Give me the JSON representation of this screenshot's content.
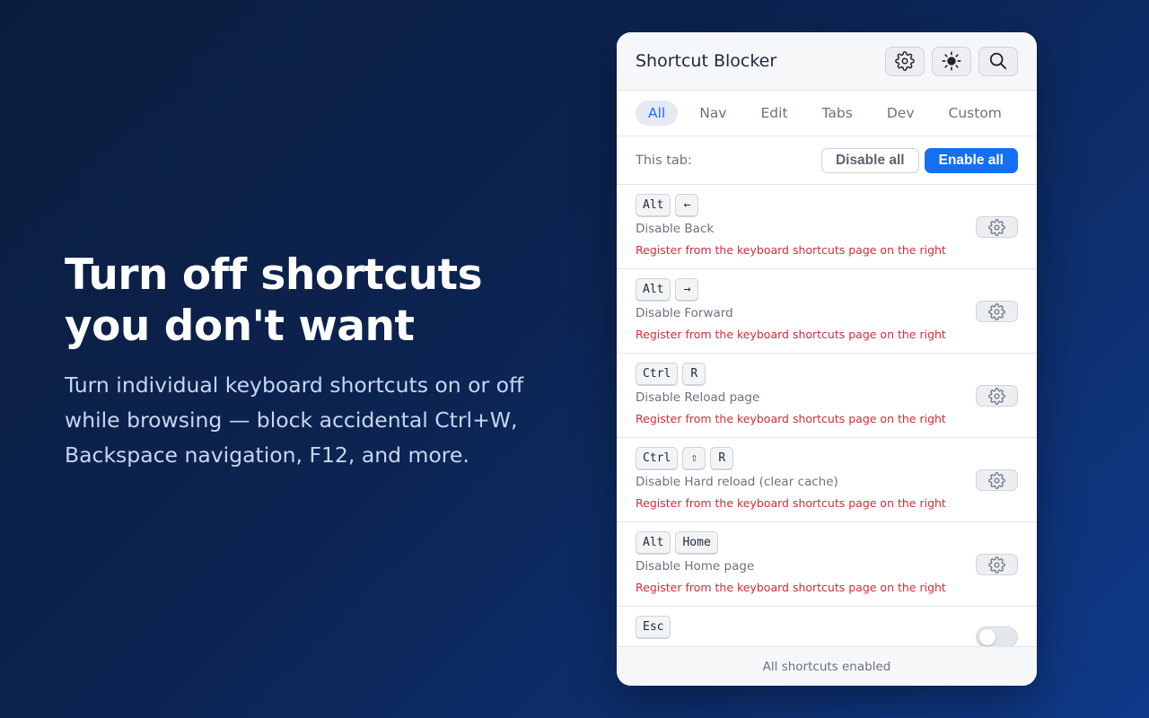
{
  "hero": {
    "title": "Turn off shortcuts you don't want",
    "subtitle": "Turn individual keyboard shortcuts on or off while browsing — block accidental Ctrl+W, Backspace navigation, F12, and more."
  },
  "panel": {
    "title": "Shortcut Blocker",
    "header_icons": [
      "gear-icon",
      "sun-icon",
      "search-icon"
    ],
    "tabs": [
      "All",
      "Nav",
      "Edit",
      "Tabs",
      "Dev",
      "Custom"
    ],
    "active_tab": "All",
    "this_tab_label": "This tab:",
    "disable_all_label": "Disable all",
    "enable_all_label": "Enable all",
    "rows": [
      {
        "keys": [
          "Alt",
          "←"
        ],
        "label": "Disable Back",
        "note": "Register from the keyboard shortcuts page on the right"
      },
      {
        "keys": [
          "Alt",
          "→"
        ],
        "label": "Disable Forward",
        "note": "Register from the keyboard shortcuts page on the right"
      },
      {
        "keys": [
          "Ctrl",
          "R"
        ],
        "label": "Disable Reload page",
        "note": "Register from the keyboard shortcuts page on the right"
      },
      {
        "keys": [
          "Ctrl",
          "⇧",
          "R"
        ],
        "label": "Disable Hard reload (clear cache)",
        "note": "Register from the keyboard shortcuts page on the right"
      },
      {
        "keys": [
          "Alt",
          "Home"
        ],
        "label": "Disable Home page",
        "note": "Register from the keyboard shortcuts page on the right"
      },
      {
        "keys": [
          "Esc"
        ],
        "label": "",
        "note": "",
        "toggle": false
      }
    ],
    "footer": "All shortcuts enabled"
  },
  "colors": {
    "accent": "#1470f2",
    "warning_text": "#d02d3c",
    "bg_start": "#0b1d3d",
    "bg_end": "#0f3a8a"
  }
}
